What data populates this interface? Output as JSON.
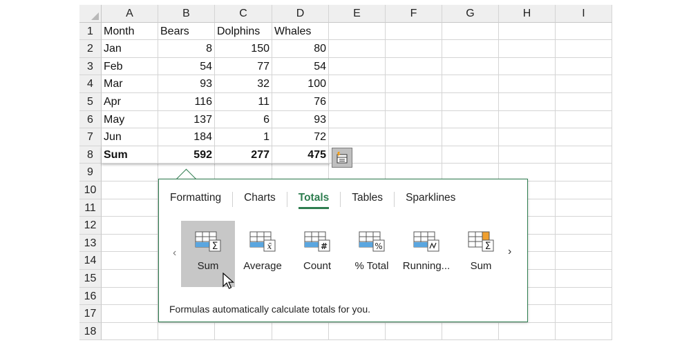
{
  "columns": [
    "A",
    "B",
    "C",
    "D",
    "E",
    "F",
    "G",
    "H",
    "I"
  ],
  "rows": [
    {
      "n": "1",
      "a": "Month",
      "b": "Bears",
      "c": "Dolphins",
      "d": "Whales"
    },
    {
      "n": "2",
      "a": "Jan",
      "b": "8",
      "c": "150",
      "d": "80"
    },
    {
      "n": "3",
      "a": "Feb",
      "b": "54",
      "c": "77",
      "d": "54"
    },
    {
      "n": "4",
      "a": "Mar",
      "b": "93",
      "c": "32",
      "d": "100"
    },
    {
      "n": "5",
      "a": "Apr",
      "b": "116",
      "c": "11",
      "d": "76"
    },
    {
      "n": "6",
      "a": "May",
      "b": "137",
      "c": "6",
      "d": "93"
    },
    {
      "n": "7",
      "a": "Jun",
      "b": "184",
      "c": "1",
      "d": "72"
    },
    {
      "n": "8",
      "a": "Sum",
      "b": "592",
      "c": "277",
      "d": "475"
    },
    {
      "n": "9",
      "a": "",
      "b": "",
      "c": "",
      "d": ""
    },
    {
      "n": "10",
      "a": "",
      "b": "",
      "c": "",
      "d": ""
    },
    {
      "n": "11",
      "a": "",
      "b": "",
      "c": "",
      "d": ""
    },
    {
      "n": "12",
      "a": "",
      "b": "",
      "c": "",
      "d": ""
    },
    {
      "n": "13",
      "a": "",
      "b": "",
      "c": "",
      "d": ""
    },
    {
      "n": "14",
      "a": "",
      "b": "",
      "c": "",
      "d": ""
    },
    {
      "n": "15",
      "a": "",
      "b": "",
      "c": "",
      "d": ""
    },
    {
      "n": "16",
      "a": "",
      "b": "",
      "c": "",
      "d": ""
    },
    {
      "n": "17",
      "a": "",
      "b": "",
      "c": "",
      "d": ""
    },
    {
      "n": "18",
      "a": "",
      "b": "",
      "c": "",
      "d": ""
    }
  ],
  "quick_analysis": {
    "tabs": [
      "Formatting",
      "Charts",
      "Totals",
      "Tables",
      "Sparklines"
    ],
    "active_tab": "Totals",
    "tools": [
      {
        "label": "Sum",
        "icon": "sum-rows-icon"
      },
      {
        "label": "Average",
        "icon": "average-icon"
      },
      {
        "label": "Count",
        "icon": "count-icon"
      },
      {
        "label": "% Total",
        "icon": "percent-total-icon"
      },
      {
        "label": "Running...",
        "icon": "running-total-icon"
      },
      {
        "label": "Sum",
        "icon": "sum-columns-icon"
      }
    ],
    "selected_tool": "Sum",
    "hint": "Formulas automatically calculate totals for you.",
    "prev_arrow": "‹",
    "next_arrow": "›"
  },
  "colors": {
    "accent_green": "#2e7d4f",
    "tile_blue": "#5aa6e0",
    "tile_orange": "#f0a030",
    "selected_tile": "#c7c7c7"
  }
}
